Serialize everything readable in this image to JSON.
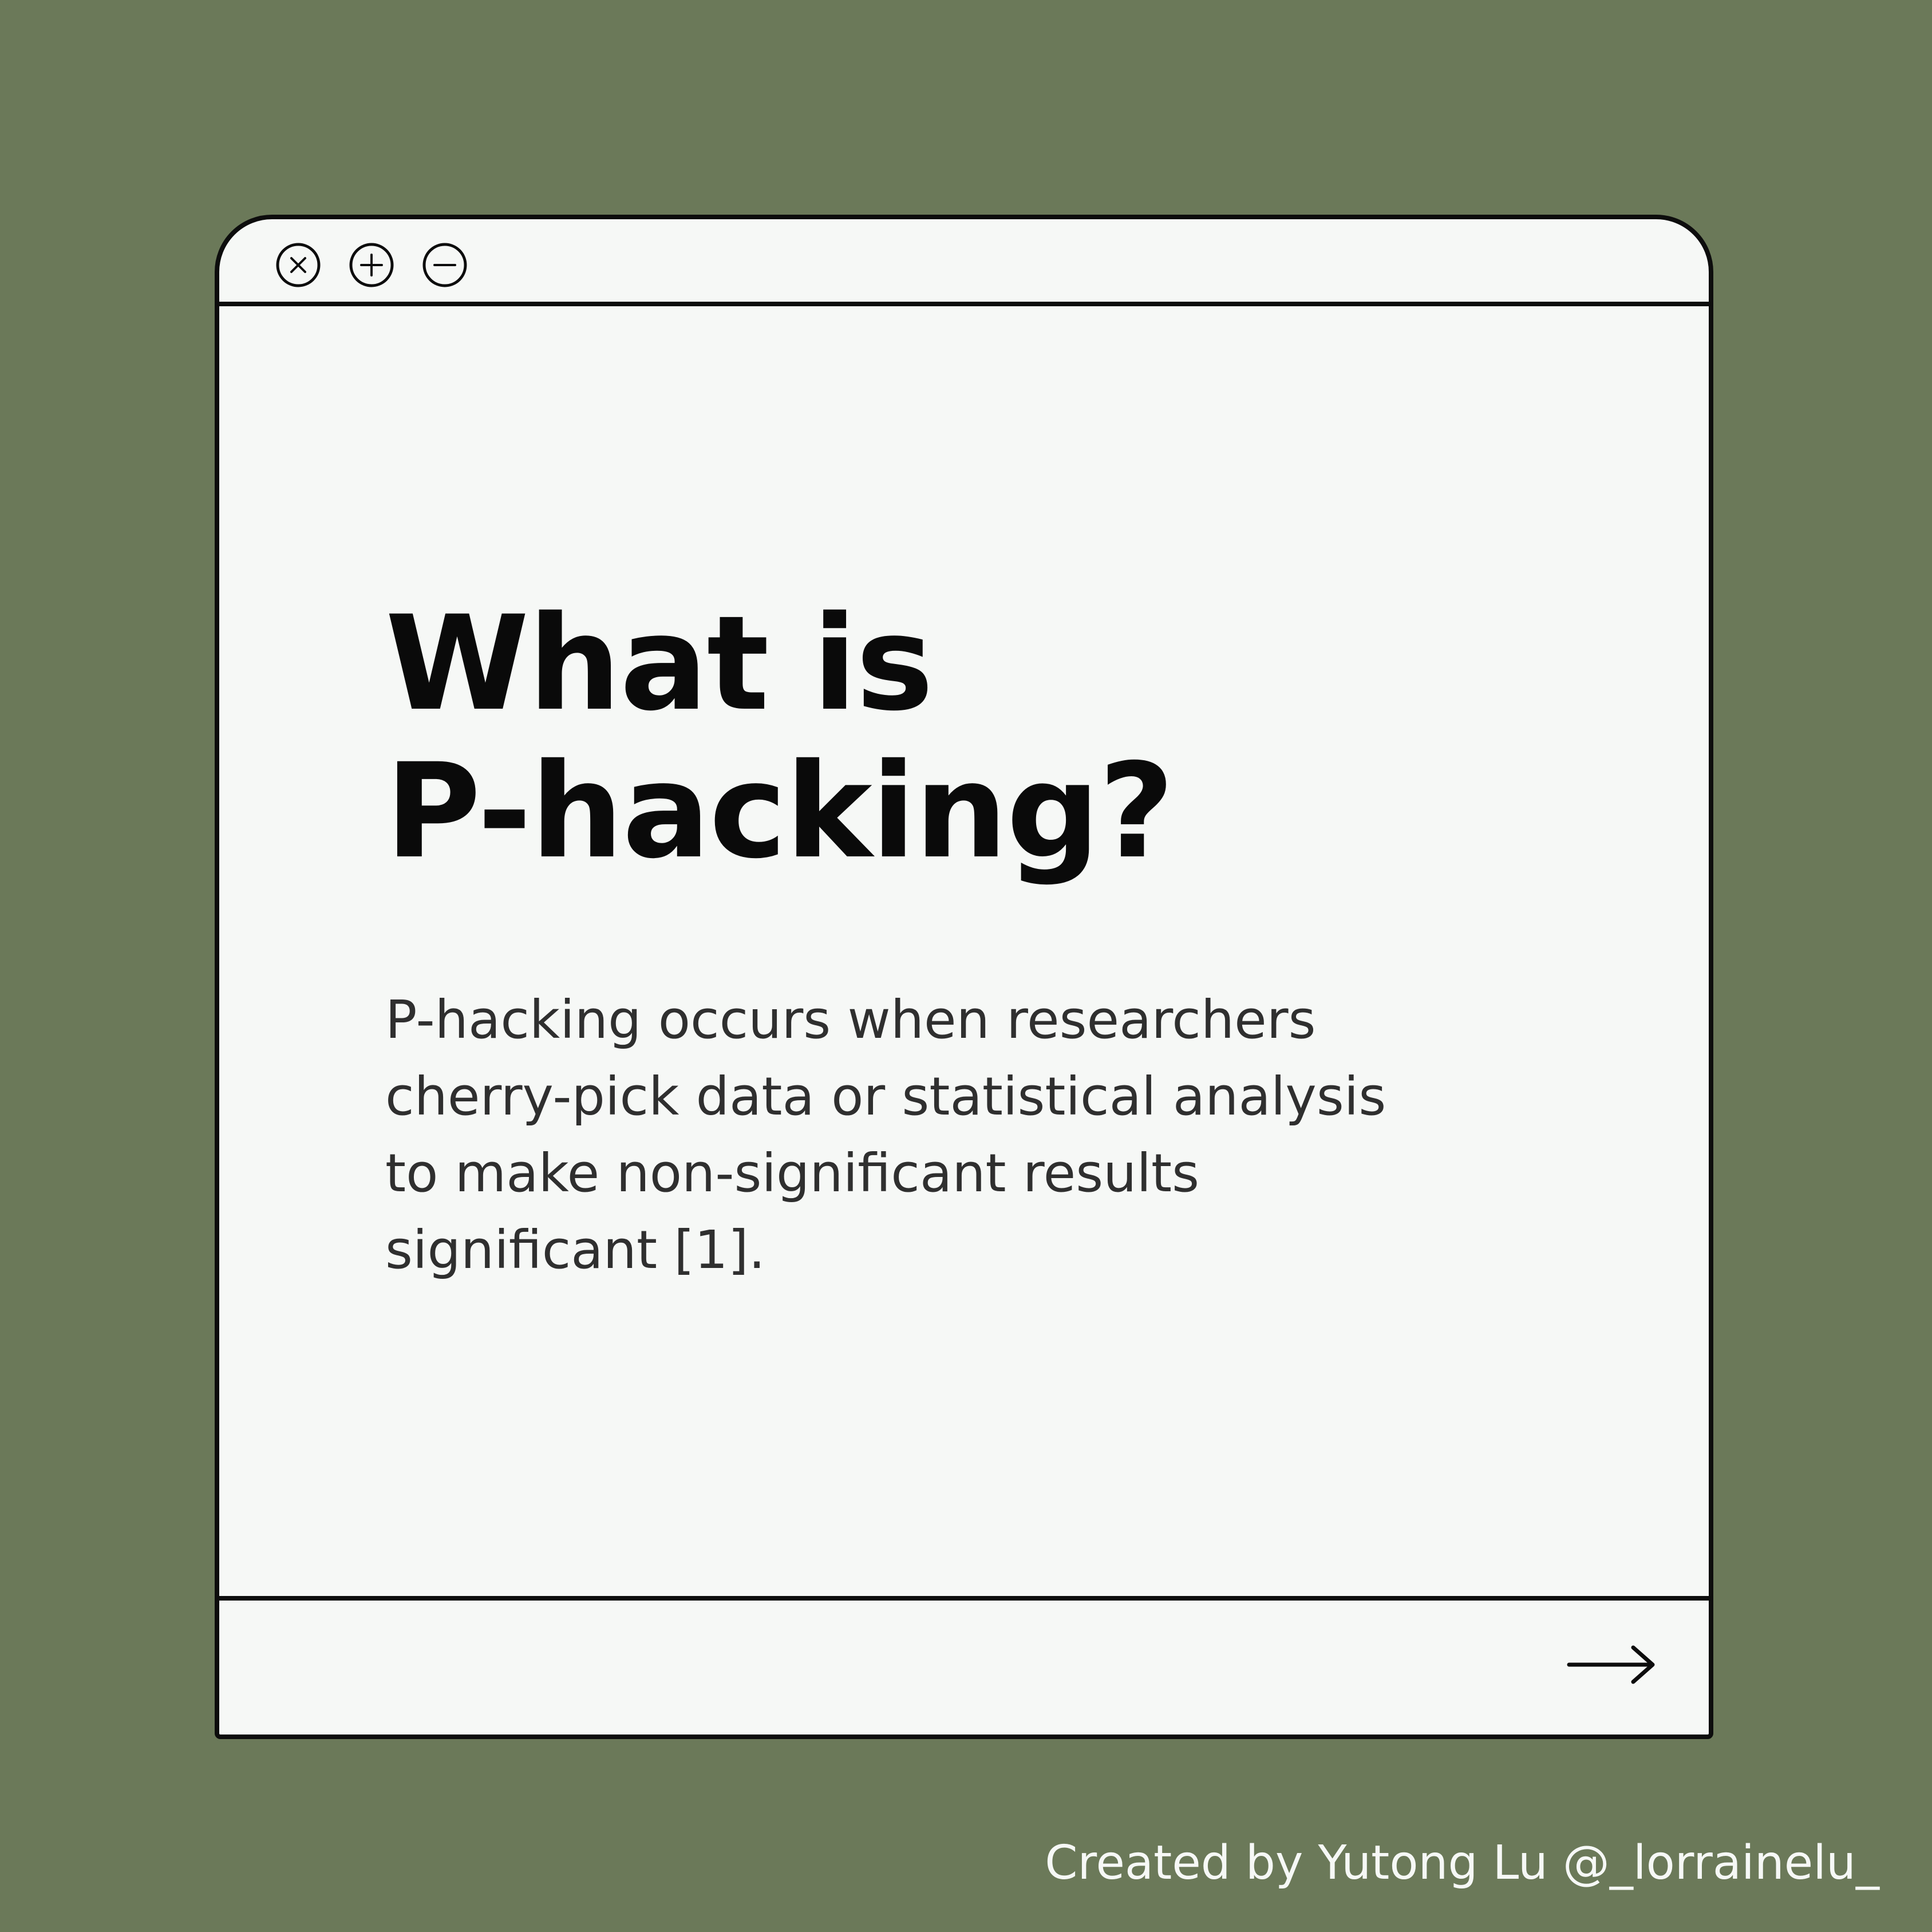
{
  "window": {
    "controls": [
      {
        "icon": "close-icon"
      },
      {
        "icon": "plus-icon"
      },
      {
        "icon": "minus-icon"
      }
    ]
  },
  "content": {
    "title_lines": [
      "What is",
      "P-hacking?"
    ],
    "description_lines": [
      "P-hacking occurs when researchers",
      "cherry-pick data or statistical analysis",
      "to make non-significant results",
      "significant [1]."
    ]
  },
  "footer": {
    "next_icon": "arrow-right-icon"
  },
  "credit": "Created by Yutong Lu @_lorrainelu_",
  "colors": {
    "background": "#6b7959",
    "window": "#f6f8f6",
    "border": "#0d0d0d",
    "title": "#0a0a0a",
    "body_text": "#2f2f2f",
    "credit_text": "#f6f8f6"
  }
}
